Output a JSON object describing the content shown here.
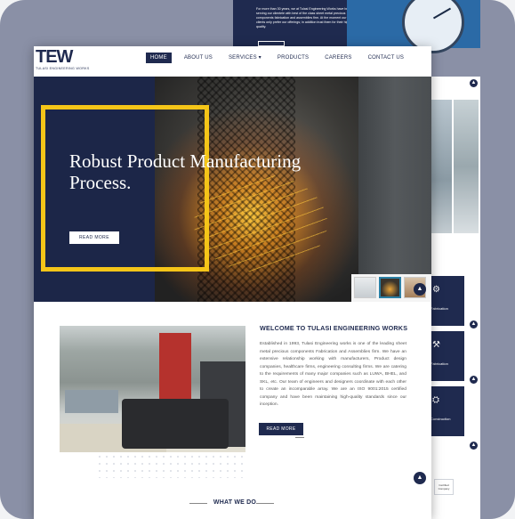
{
  "background": {
    "top_banner_text": "For more than 30 years, we at Tulasi Engineering Works have been serving our clientele with best of the class sheet metal precious components fabrication and assemblies firm. At the moment our clients only prefer our offerings; in addition trust them for their high quality.",
    "right_tiles": [
      {
        "label": "Fabrication"
      },
      {
        "label": "Fabrication"
      },
      {
        "label": "Construction"
      }
    ],
    "cert_text": "Certified Company"
  },
  "header": {
    "logo_mark": "TEW",
    "logo_tagline": "TULASI ENGINEERING WORKS",
    "nav": [
      {
        "label": "HOME",
        "active": true
      },
      {
        "label": "ABOUT US"
      },
      {
        "label": "SERVICES ▾"
      },
      {
        "label": "PRODUCTS"
      },
      {
        "label": "CAREERS"
      },
      {
        "label": "CONTACT US"
      }
    ]
  },
  "hero": {
    "heading": "Robust Product Manufacturing Process.",
    "read_more": "READ MORE"
  },
  "about": {
    "title": "WELCOME TO TULASI ENGINEERING WORKS",
    "body": "Established in 1993, Tulasi Engineering works is one of the leading sheet metal precious components Fabrication and Assemblies firm. We have an extensive relationship working with manufacturers, Product design companies, healthcare firms, engineering consulting firms. We are catering to the requirements of many major companies such as LUWA, BHEL, and SKL, etc. Our team of engineers and designers coordinate with each other to create an incomparable array. We are an ISO 9001:2015 certified company and have been maintaining high-quality standards since our inception.",
    "read_more": "READ MORE",
    "section_heading": "WHAT WE DO"
  },
  "colors": {
    "navy": "#1f2a4f",
    "accent_yellow": "#f5c518",
    "frame": "#8a90a6"
  }
}
